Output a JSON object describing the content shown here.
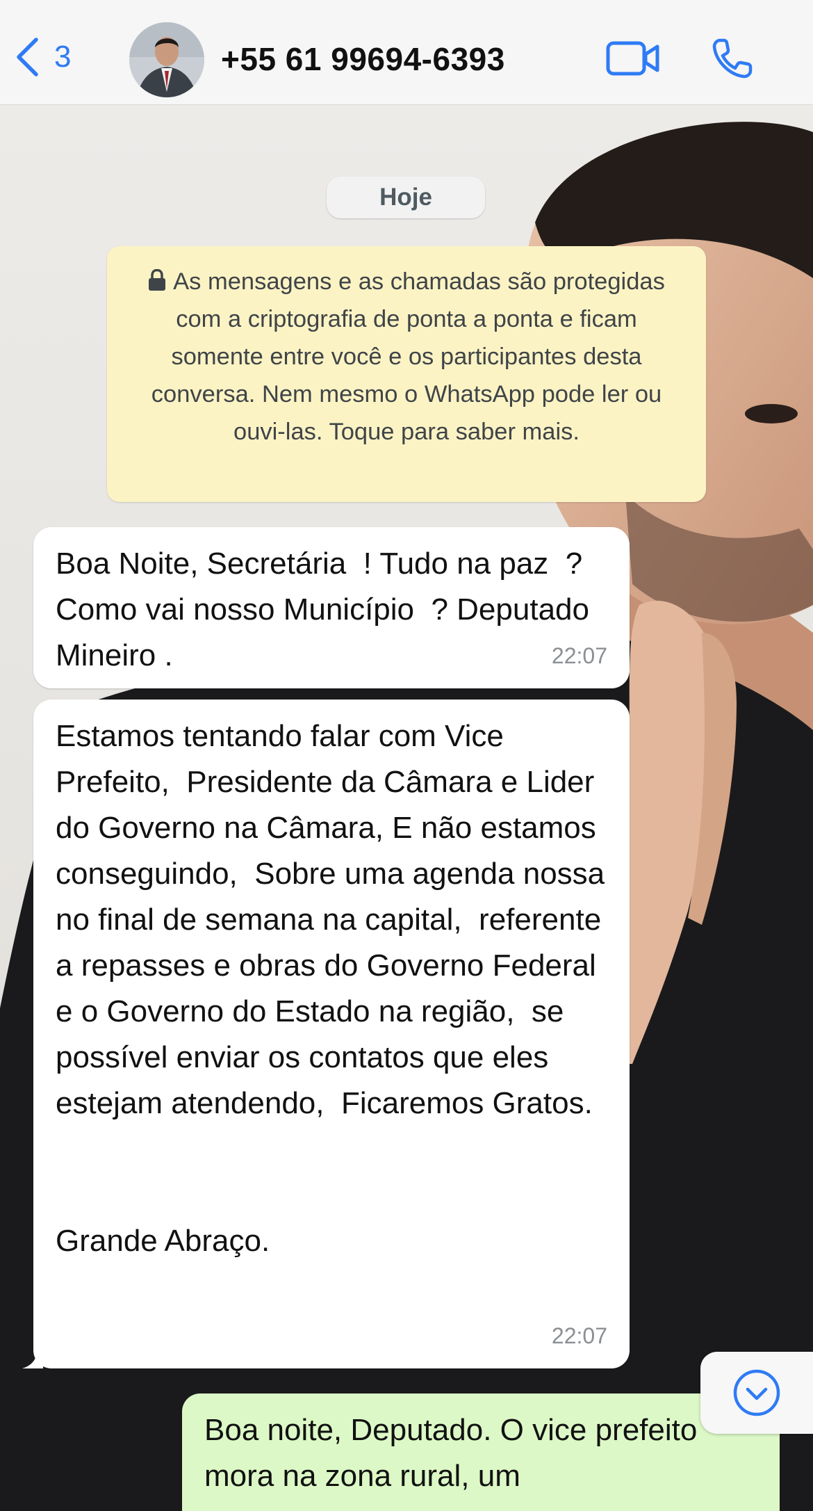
{
  "header": {
    "back_count": "3",
    "contact_name": "+55 61 99694-6393"
  },
  "chat": {
    "date_label": "Hoje",
    "encryption_notice": "As mensagens e as chamadas são protegidas com a criptografia de ponta a ponta e ficam somente entre você e os participantes desta conversa. Nem mesmo o WhatsApp pode ler ou ouvi-las. Toque para saber mais.",
    "messages": [
      {
        "direction": "incoming",
        "text": "Boa Noite, Secretária  ! Tudo na paz  ? Como vai nosso Município  ? Deputado Mineiro .",
        "time": "22:07"
      },
      {
        "direction": "incoming",
        "text": "Estamos tentando falar com Vice Prefeito,  Presidente da Câmara e Lider do Governo na Câmara, E não estamos conseguindo,  Sobre uma agenda nossa no final de semana na capital,  referente a repasses e obras do Governo Federal e o Governo do Estado na região,  se possível enviar os contatos que eles estejam atendendo,  Ficaremos Gratos.\n\n\nGrande Abraço.",
        "time": "22:07"
      },
      {
        "direction": "outgoing",
        "text": "Boa noite, Deputado. O vice prefeito mora na zona rural, um"
      }
    ]
  },
  "icons": {
    "back": "chevron-left-icon",
    "video": "video-camera-icon",
    "call": "phone-icon",
    "lock": "lock-icon",
    "scroll_down": "chevron-down-circle-icon"
  },
  "colors": {
    "accent": "#2f7bf5",
    "incoming_bubble": "#ffffff",
    "outgoing_bubble": "#dcf8c6",
    "notice_bg": "#fcf3c4",
    "header_bg": "#f6f6f6"
  }
}
